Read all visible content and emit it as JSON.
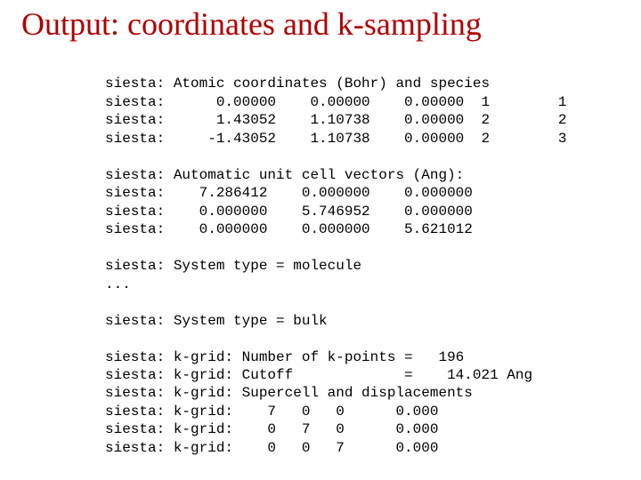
{
  "title": "Output: coordinates and k-sampling",
  "code": {
    "coord_header": "siesta: Atomic coordinates (Bohr) and species",
    "coord_rows": [
      "siesta:      0.00000    0.00000    0.00000  1        1",
      "siesta:      1.43052    1.10738    0.00000  2        2",
      "siesta:     -1.43052    1.10738    0.00000  2        3"
    ],
    "cell_header": "siesta: Automatic unit cell vectors (Ang):",
    "cell_rows": [
      "siesta:    7.286412    0.000000    0.000000",
      "siesta:    0.000000    5.746952    0.000000",
      "siesta:    0.000000    0.000000    5.621012"
    ],
    "type_molecule": "siesta: System type = molecule",
    "ellipsis": "...",
    "type_bulk": "siesta: System type = bulk",
    "kgrid_npoints": "siesta: k-grid: Number of k-points =   196",
    "kgrid_cutoff": "siesta: k-grid: Cutoff             =    14.021 Ang",
    "kgrid_super": "siesta: k-grid: Supercell and displacements",
    "kgrid_rows": [
      "siesta: k-grid:    7   0   0      0.000",
      "siesta: k-grid:    0   7   0      0.000",
      "siesta: k-grid:    0   0   7      0.000"
    ]
  }
}
